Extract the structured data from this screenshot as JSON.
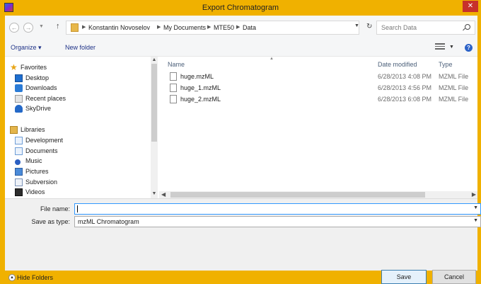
{
  "window": {
    "title": "Export Chromatogram",
    "close_glyph": "✕"
  },
  "address": {
    "crumbs": [
      "Konstantin Novoselov",
      "My Documents",
      "MTE50",
      "Data"
    ],
    "search_placeholder": "Search Data"
  },
  "toolbar": {
    "organize_label": "Organize ▾",
    "new_folder_label": "New folder",
    "help_glyph": "?"
  },
  "nav": {
    "favorites_header": "Favorites",
    "favorites": [
      "Desktop",
      "Downloads",
      "Recent places",
      "SkyDrive"
    ],
    "libraries_header": "Libraries",
    "libraries": [
      "Development",
      "Documents",
      "Music",
      "Pictures",
      "Subversion",
      "Videos"
    ]
  },
  "columns": {
    "name": "Name",
    "date": "Date modified",
    "type": "Type"
  },
  "files": [
    {
      "name": "huge.mzML",
      "date": "6/28/2013 4:08 PM",
      "type": "MZML File"
    },
    {
      "name": "huge_1.mzML",
      "date": "6/28/2013 4:56 PM",
      "type": "MZML File"
    },
    {
      "name": "huge_2.mzML",
      "date": "6/28/2013 6:08 PM",
      "type": "MZML File"
    }
  ],
  "form": {
    "file_name_label": "File name:",
    "file_name_value": "",
    "save_as_type_label": "Save as type:",
    "save_as_type_value": "mzML Chromatogram"
  },
  "footer": {
    "hide_folders_label": "Hide Folders",
    "save_label": "Save",
    "cancel_label": "Cancel"
  },
  "colors": {
    "frame": "#f0b100",
    "close": "#c7312b",
    "accent": "#3399ff"
  }
}
